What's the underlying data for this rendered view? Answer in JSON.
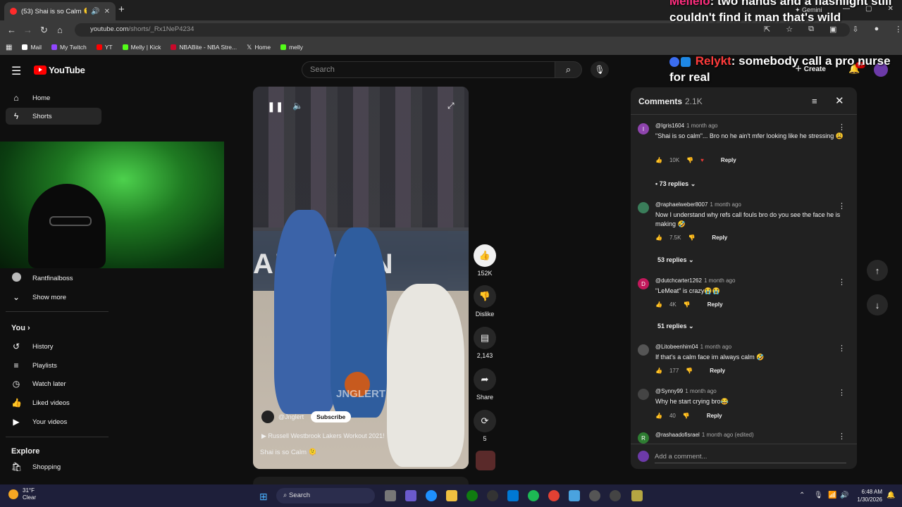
{
  "browser": {
    "tab_title": "(53) Shai is so Calm 🫠 - Yo",
    "url_host": "youtube.com",
    "url_path": "/shorts/_Rx1NeP4234",
    "bookmarks": [
      "Mail",
      "My Twitch",
      "YT",
      "Melly | Kick",
      "NBABite - NBA Stre...",
      "Home",
      "melly"
    ],
    "gemini_label": "Gemini"
  },
  "youtube": {
    "logo_text": "YouTube",
    "search_placeholder": "Search",
    "create_label": "Create",
    "notification_count": "9+"
  },
  "sidebar": {
    "top_items": [
      {
        "label": "Home",
        "icon": "home-icon"
      },
      {
        "label": "Shorts",
        "icon": "shorts-icon",
        "active": true
      }
    ],
    "subscriptions": [
      {
        "label": "Rantfinalboss",
        "icon": "avatar"
      },
      {
        "label": "Show more",
        "icon": "chevron-down-icon"
      }
    ],
    "you_heading": "You",
    "you_items": [
      {
        "label": "History",
        "icon": "history-icon"
      },
      {
        "label": "Playlists",
        "icon": "playlists-icon"
      },
      {
        "label": "Watch later",
        "icon": "watch-later-icon"
      },
      {
        "label": "Liked videos",
        "icon": "like-icon"
      },
      {
        "label": "Your videos",
        "icon": "your-videos-icon"
      }
    ],
    "explore_heading": "Explore",
    "explore_items": [
      {
        "label": "Shopping",
        "icon": "shopping-icon"
      }
    ]
  },
  "short": {
    "channel": "@Jnglert",
    "subscribe_label": "Subscribe",
    "linked_video": "Russell Westbrook Lakers Workout 2021!",
    "caption": "Shai is so Calm 🫠",
    "watermark": "JNGLERT",
    "arena_board": "AME  CAN"
  },
  "actions": {
    "likes": "152K",
    "dislike_label": "Dislike",
    "comments": "2,143",
    "share_label": "Share",
    "remix": "5"
  },
  "chat_overlay": {
    "line1_name": "Mellelo",
    "line1_text": ": two hands and a flashlight still couldn't find it man that's wild",
    "line2_name": "Relykt",
    "line2_text": ": somebody call a pro nurse for real"
  },
  "comments": {
    "title": "Comments",
    "count": "2.1K",
    "add_placeholder": "Add a comment...",
    "reply_label": "Reply",
    "items": [
      {
        "user": "@Igris1604",
        "time": "1 month ago",
        "text": "\"Shai is so calm\"... Bro no he ain't mfer looking like he stressing 😩",
        "likes": "10K",
        "replies": "• 73 replies",
        "initial": "I",
        "color": "#8e44ad"
      },
      {
        "user": "@raphaelweber8007",
        "time": "1 month ago",
        "text": "Now I understand why refs call fouls bro do you see the face he is making 🤣",
        "likes": "7.5K",
        "replies": "53 replies",
        "initial": "",
        "color": "#3a7d5a"
      },
      {
        "user": "@dutchcarter1262",
        "time": "1 month ago",
        "text": "\"LeMeat\" is crazy😭😭",
        "likes": "4K",
        "replies": "51 replies",
        "initial": "D",
        "color": "#c2185b"
      },
      {
        "user": "@Litobeenhim04",
        "time": "1 month ago",
        "text": "If that's a calm face im always calm 🤣",
        "likes": "177",
        "replies": "",
        "initial": "",
        "color": "#555555"
      },
      {
        "user": "@Synny99",
        "time": "1 month ago",
        "text": "Why he start crying bro😂",
        "likes": "40",
        "replies": "",
        "initial": "",
        "color": "#444444"
      },
      {
        "user": "@rashaadofisrael",
        "time": "1 month ago (edited)",
        "text": "",
        "likes": "",
        "replies": "",
        "initial": "R",
        "color": "#2e7d32"
      }
    ]
  },
  "taskbar": {
    "temp": "31°F",
    "condition": "Clear",
    "search_label": "Search",
    "time": "6:48 AM",
    "date": "1/30/2026"
  }
}
